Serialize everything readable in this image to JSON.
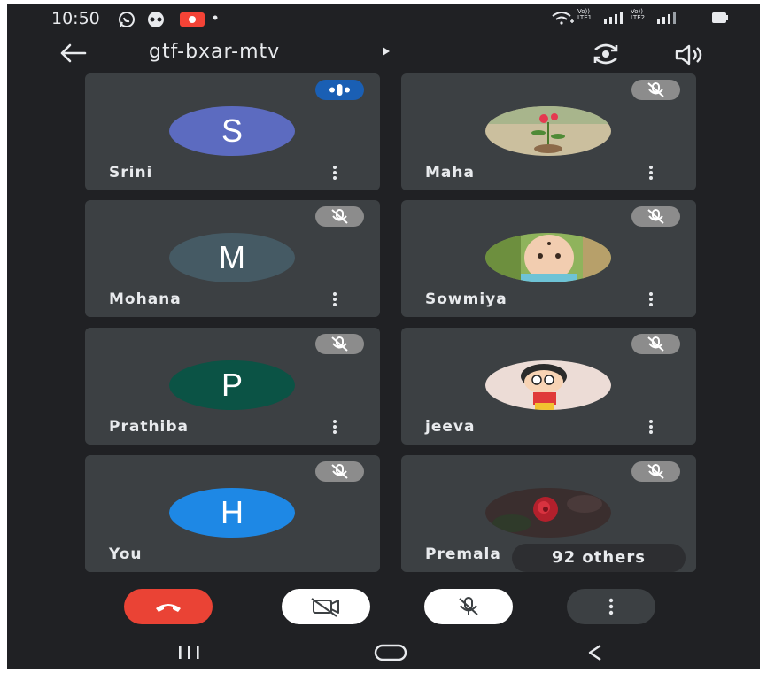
{
  "status_bar": {
    "time": "10:50",
    "icons": [
      "whatsapp-icon",
      "messenger-icon",
      "youtube-icon",
      "dot-icon",
      "wifi-icon",
      "lte1-signal-icon",
      "lte2-signal-icon",
      "battery-icon"
    ],
    "lte1_label": "Vo))\nLTE1",
    "lte2_label": "Vo))\nLTE2"
  },
  "top_bar": {
    "meeting_code": "gtf-bxar-mtv",
    "icons": [
      "back-arrow-icon",
      "flip-camera-icon",
      "speaker-icon"
    ]
  },
  "participants": [
    {
      "name": "Srini",
      "initial": "S",
      "avatar_color": "#5c6bc0",
      "status": "speaking"
    },
    {
      "name": "Maha",
      "initial": "",
      "avatar_color": "#c8b89a",
      "status": "muted",
      "photo": "flower"
    },
    {
      "name": "Mohana",
      "initial": "M",
      "avatar_color": "#455a64",
      "status": "muted"
    },
    {
      "name": "Sowmiya",
      "initial": "",
      "avatar_color": "#9bbf6c",
      "status": "muted",
      "photo": "baby"
    },
    {
      "name": "Prathiba",
      "initial": "P",
      "avatar_color": "#0b5345",
      "status": "muted"
    },
    {
      "name": "jeeva",
      "initial": "",
      "avatar_color": "#e9d9d0",
      "status": "muted",
      "photo": "cartoon"
    },
    {
      "name": "You",
      "initial": "H",
      "avatar_color": "#1e88e5",
      "status": "muted"
    },
    {
      "name": "Premala",
      "initial": "",
      "avatar_color": "#3a2e2e",
      "status": "muted",
      "photo": "rose"
    }
  ],
  "others_label": "92 others",
  "controls": {
    "end_call_color": "#ea4335",
    "icons": [
      "end-call-icon",
      "video-off-icon",
      "mic-off-icon",
      "more-options-icon"
    ]
  },
  "nav_bar": {
    "icons": [
      "recent-apps-icon",
      "home-icon",
      "back-icon"
    ]
  }
}
